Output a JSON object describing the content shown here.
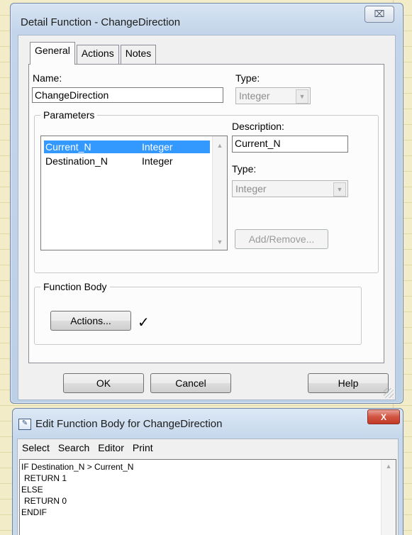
{
  "detail_window": {
    "title": "Detail Function - ChangeDirection",
    "close_glyph": "⌧",
    "tabs": [
      "General",
      "Actions",
      "Notes"
    ],
    "active_tab": "General",
    "name_label": "Name:",
    "name_value": "ChangeDirection",
    "type_label": "Type:",
    "type_value": "Integer",
    "parameters_group": "Parameters",
    "parameters": [
      {
        "name": "Current_N",
        "type": "Integer",
        "selected": true
      },
      {
        "name": "Destination_N",
        "type": "Integer",
        "selected": false
      }
    ],
    "description_label": "Description:",
    "description_value": "Current_N",
    "param_type_label": "Type:",
    "param_type_value": "Integer",
    "add_remove_label": "Add/Remove...",
    "function_body_group": "Function Body",
    "actions_button": "Actions...",
    "checkmark": "✓",
    "ok_button": "OK",
    "cancel_button": "Cancel",
    "help_button": "Help"
  },
  "editor_window": {
    "title": "Edit Function Body for ChangeDirection",
    "close_glyph": "X",
    "menu": [
      "Select",
      "Search",
      "Editor",
      "Print"
    ],
    "code_lines": [
      "IF Destination_N > Current_N",
      "  RETURN 1",
      "ELSE",
      "  RETURN 0",
      "ENDIF"
    ]
  },
  "icons": {
    "scroll_up": "▲",
    "scroll_down": "▼",
    "dropdown": "▼"
  }
}
